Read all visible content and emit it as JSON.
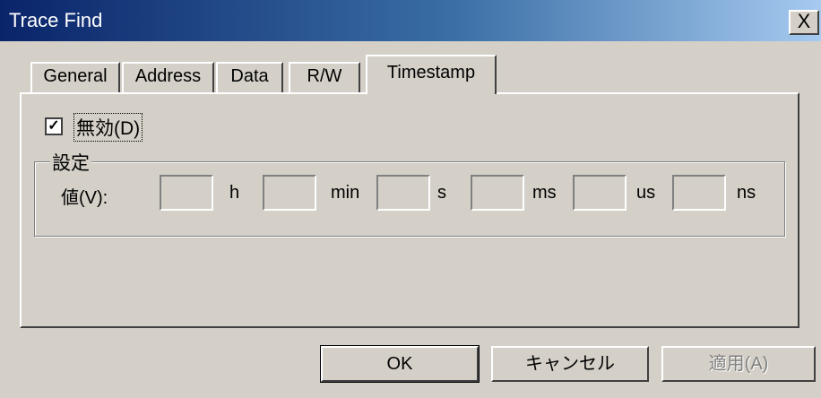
{
  "window": {
    "title": "Trace Find",
    "close_glyph": "X"
  },
  "tabs": [
    {
      "label": "General",
      "active": false
    },
    {
      "label": "Address",
      "active": false
    },
    {
      "label": "Data",
      "active": false
    },
    {
      "label": "R/W",
      "active": false
    },
    {
      "label": "Timestamp",
      "active": true
    }
  ],
  "timestamp": {
    "disable_checkbox": {
      "label": "無効(D)",
      "checked": true,
      "check_glyph": "✓"
    },
    "settings_group": {
      "title": "設定",
      "value_label": "値(V):",
      "fields": [
        {
          "unit": "h",
          "value": ""
        },
        {
          "unit": "min",
          "value": ""
        },
        {
          "unit": "s",
          "value": ""
        },
        {
          "unit": "ms",
          "value": ""
        },
        {
          "unit": "us",
          "value": ""
        },
        {
          "unit": "ns",
          "value": ""
        }
      ]
    }
  },
  "buttons": {
    "ok": "OK",
    "cancel": "キャンセル",
    "apply": "適用(A)",
    "apply_enabled": false
  },
  "colors": {
    "face": "#d4d0c8",
    "title_gradient_start": "#0a246a",
    "title_gradient_end": "#a6caf0",
    "disabled_text": "#808080"
  }
}
